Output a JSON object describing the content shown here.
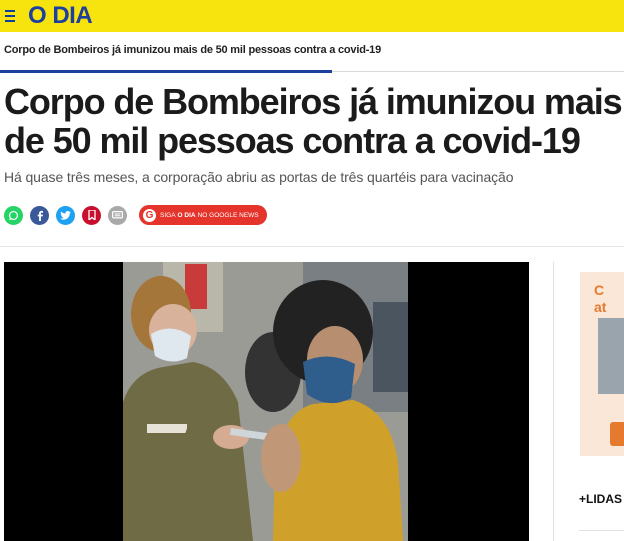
{
  "header": {
    "logo": "O DIA",
    "menu_icon": "hamburger-icon",
    "bg_color": "#f7e40f",
    "brand_color": "#1d3f9e"
  },
  "breadcrumb": {
    "title": "Corpo de Bombeiros já imunizou mais de 50 mil pessoas contra a covid-19"
  },
  "article": {
    "headline": "Corpo de Bombeiros já imunizou mais de 50 mil pessoas contra a covid-19",
    "subtitle": "Há quase três meses, a corporação abriu as portas de três quartéis para vacinação"
  },
  "share": {
    "buttons": [
      {
        "icon": "whatsapp-icon",
        "color": "#25d366"
      },
      {
        "icon": "facebook-icon",
        "color": "#3b5998"
      },
      {
        "icon": "twitter-icon",
        "color": "#1da1f2"
      },
      {
        "icon": "bookmark-icon",
        "color": "#c8102e"
      },
      {
        "icon": "comment-icon",
        "color": "#a9a9a9"
      }
    ],
    "google_news": {
      "prefix": "SIGA",
      "brand": "O DIA",
      "suffix": "NO GOOGLE NEWS",
      "icon": "google-icon",
      "color": "#e4342b"
    }
  },
  "sidebar": {
    "ad_text": "C\nat",
    "section_label": "+LIDAS"
  }
}
